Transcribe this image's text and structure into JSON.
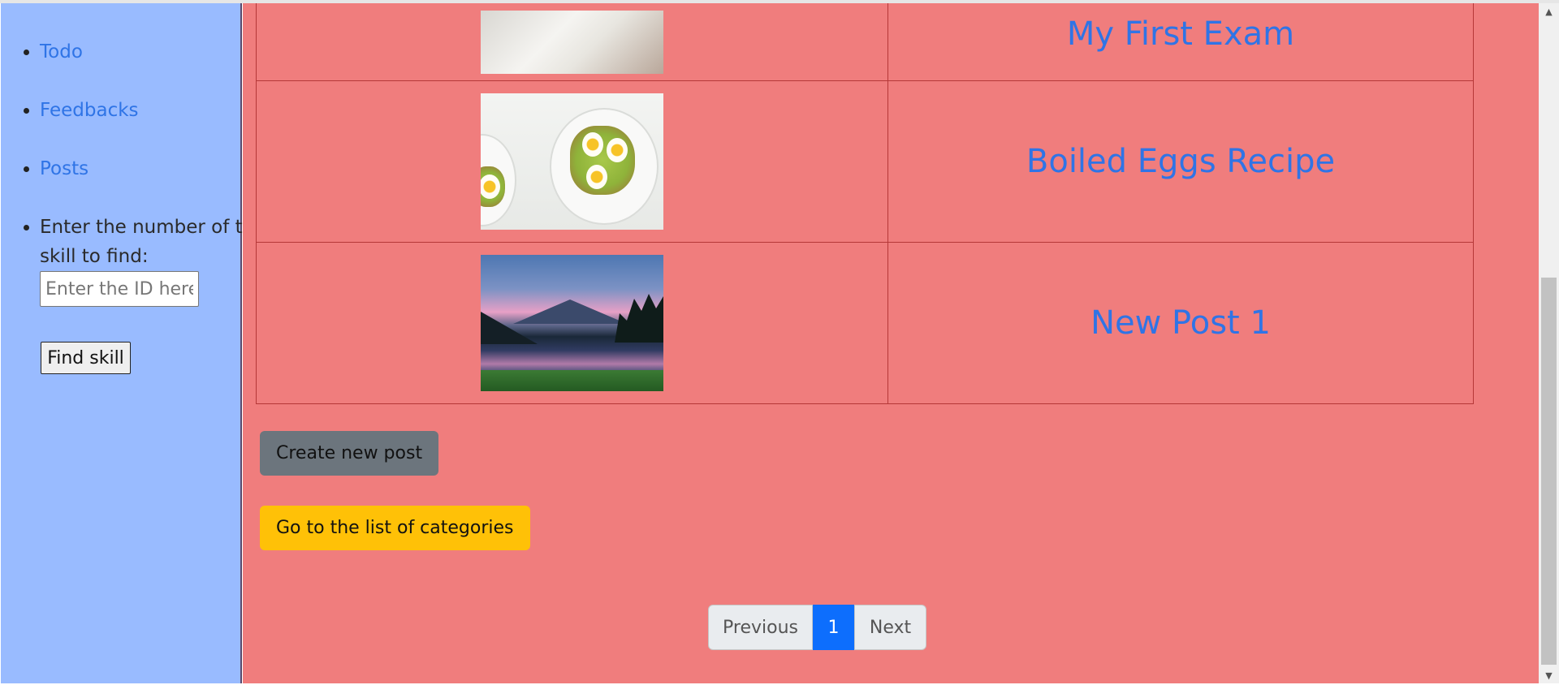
{
  "sidebar": {
    "nav": [
      {
        "label": "Todo"
      },
      {
        "label": "Feedbacks"
      },
      {
        "label": "Posts"
      }
    ],
    "search": {
      "label": "Enter the number of the skill to find:",
      "placeholder": "Enter the ID here",
      "value": "",
      "button_label": "Find skill"
    }
  },
  "posts": [
    {
      "title": "My First Exam",
      "image": "writing-exam-photo"
    },
    {
      "title": "Boiled Eggs Recipe",
      "image": "avocado-toast-eggs-photo"
    },
    {
      "title": "New Post 1",
      "image": "mountain-lake-photo"
    }
  ],
  "actions": {
    "create_label": "Create new post",
    "categories_label": "Go to the list of categories"
  },
  "pagination": {
    "previous_label": "Previous",
    "current_page": "1",
    "next_label": "Next"
  },
  "colors": {
    "sidebar_bg": "#99bbff",
    "main_bg": "#f07d7d",
    "link": "#2f74e6",
    "create_btn": "#6c757d",
    "categories_btn": "#ffc107",
    "active_page": "#0d6efd"
  },
  "scrollbar": {
    "icons": [
      "scroll-up-arrow-icon",
      "scroll-down-arrow-icon"
    ]
  }
}
